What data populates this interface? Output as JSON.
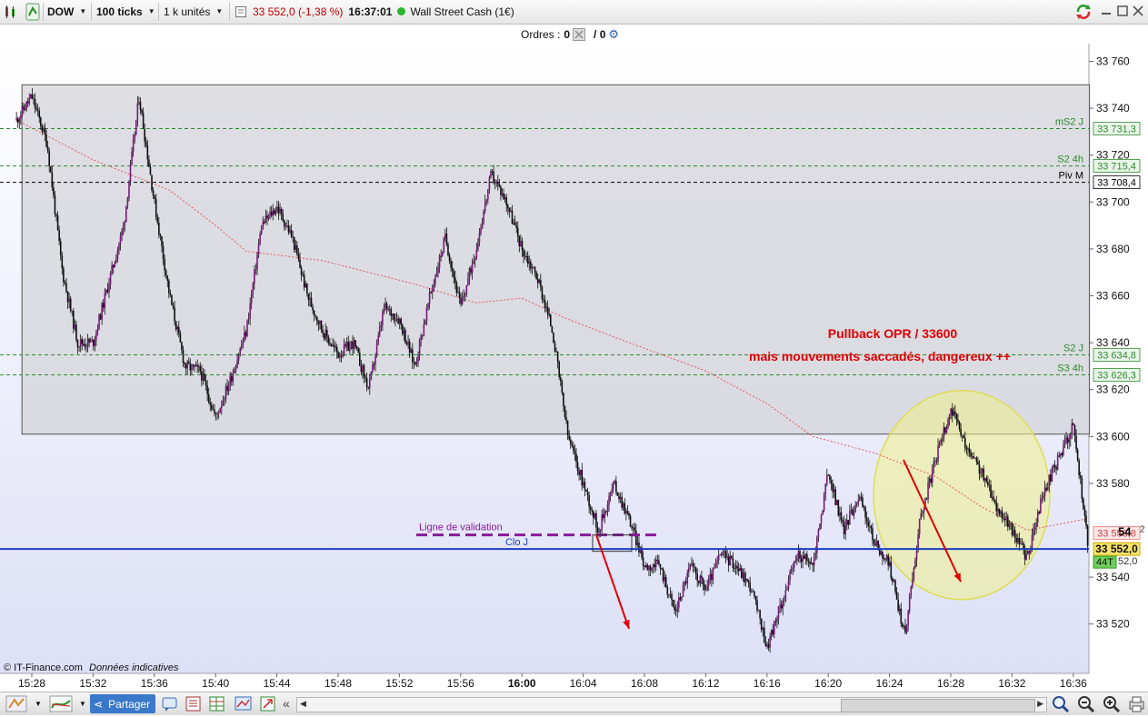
{
  "toolbar": {
    "symbol": "DOW",
    "period": "100 ticks",
    "units": "1 k unités",
    "price_change": "33 552,0 (-1,38 %)",
    "time": "16:37:01",
    "instrument": "Wall Street Cash (1€)"
  },
  "orders": {
    "label": "Ordres :",
    "count1": "0",
    "count2": "/ 0"
  },
  "chart_data": {
    "type": "candlestick",
    "title": "",
    "xlabel": "",
    "ylabel": "",
    "ylim": [
      33505,
      33768
    ],
    "x_ticks": [
      "15:28",
      "15:32",
      "15:36",
      "15:40",
      "15:44",
      "15:48",
      "15:52",
      "15:56",
      "16:00",
      "16:04",
      "16:08",
      "16:12",
      "16:16",
      "16:20",
      "16:24",
      "16:28",
      "16:32",
      "16:36"
    ],
    "y_ticks": [
      "33 760",
      "33 740",
      "33 720",
      "33 700",
      "33 680",
      "33 660",
      "33 640",
      "33 620",
      "33 600",
      "33 580",
      "33 540",
      "33 520"
    ],
    "path_anchors": [
      {
        "t": "15:27",
        "v": 33735
      },
      {
        "t": "15:28",
        "v": 33745
      },
      {
        "t": "15:29",
        "v": 33725
      },
      {
        "t": "15:30",
        "v": 33670
      },
      {
        "t": "15:31",
        "v": 33640
      },
      {
        "t": "15:32",
        "v": 33640
      },
      {
        "t": "15:33",
        "v": 33665
      },
      {
        "t": "15:34",
        "v": 33690
      },
      {
        "t": "15:35",
        "v": 33745
      },
      {
        "t": "15:36",
        "v": 33700
      },
      {
        "t": "15:37",
        "v": 33660
      },
      {
        "t": "15:38",
        "v": 33630
      },
      {
        "t": "15:39",
        "v": 33628
      },
      {
        "t": "15:40",
        "v": 33608
      },
      {
        "t": "15:41",
        "v": 33625
      },
      {
        "t": "15:42",
        "v": 33645
      },
      {
        "t": "15:43",
        "v": 33690
      },
      {
        "t": "15:44",
        "v": 33698
      },
      {
        "t": "15:45",
        "v": 33685
      },
      {
        "t": "15:46",
        "v": 33660
      },
      {
        "t": "15:47",
        "v": 33645
      },
      {
        "t": "15:48",
        "v": 33635
      },
      {
        "t": "15:49",
        "v": 33640
      },
      {
        "t": "15:50",
        "v": 33620
      },
      {
        "t": "15:51",
        "v": 33655
      },
      {
        "t": "15:52",
        "v": 33650
      },
      {
        "t": "15:53",
        "v": 33630
      },
      {
        "t": "15:54",
        "v": 33660
      },
      {
        "t": "15:55",
        "v": 33685
      },
      {
        "t": "15:56",
        "v": 33655
      },
      {
        "t": "15:57",
        "v": 33680
      },
      {
        "t": "15:58",
        "v": 33712
      },
      {
        "t": "15:59",
        "v": 33700
      },
      {
        "t": "16:00",
        "v": 33680
      },
      {
        "t": "16:01",
        "v": 33668
      },
      {
        "t": "16:02",
        "v": 33645
      },
      {
        "t": "16:03",
        "v": 33600
      },
      {
        "t": "16:04",
        "v": 33580
      },
      {
        "t": "16:05",
        "v": 33560
      },
      {
        "t": "16:06",
        "v": 33580
      },
      {
        "t": "16:07",
        "v": 33565
      },
      {
        "t": "16:08",
        "v": 33545
      },
      {
        "t": "16:09",
        "v": 33545
      },
      {
        "t": "16:10",
        "v": 33525
      },
      {
        "t": "16:11",
        "v": 33545
      },
      {
        "t": "16:12",
        "v": 33535
      },
      {
        "t": "16:13",
        "v": 33550
      },
      {
        "t": "16:14",
        "v": 33545
      },
      {
        "t": "16:15",
        "v": 33535
      },
      {
        "t": "16:16",
        "v": 33510
      },
      {
        "t": "16:17",
        "v": 33530
      },
      {
        "t": "16:18",
        "v": 33550
      },
      {
        "t": "16:19",
        "v": 33545
      },
      {
        "t": "16:20",
        "v": 33585
      },
      {
        "t": "16:21",
        "v": 33560
      },
      {
        "t": "16:22",
        "v": 33575
      },
      {
        "t": "16:23",
        "v": 33555
      },
      {
        "t": "16:24",
        "v": 33545
      },
      {
        "t": "16:25",
        "v": 33515
      },
      {
        "t": "16:26",
        "v": 33565
      },
      {
        "t": "16:27",
        "v": 33590
      },
      {
        "t": "16:28",
        "v": 33612
      },
      {
        "t": "16:29",
        "v": 33595
      },
      {
        "t": "16:30",
        "v": 33585
      },
      {
        "t": "16:31",
        "v": 33570
      },
      {
        "t": "16:32",
        "v": 33560
      },
      {
        "t": "16:33",
        "v": 33548
      },
      {
        "t": "16:34",
        "v": 33575
      },
      {
        "t": "16:35",
        "v": 33590
      },
      {
        "t": "16:36",
        "v": 33605
      },
      {
        "t": "16:37",
        "v": 33552
      }
    ],
    "ma_anchors": [
      {
        "t": "15:27",
        "v": 33735
      },
      {
        "t": "15:32",
        "v": 33718
      },
      {
        "t": "15:37",
        "v": 33705
      },
      {
        "t": "15:40",
        "v": 33690
      },
      {
        "t": "15:42",
        "v": 33679
      },
      {
        "t": "15:47",
        "v": 33675
      },
      {
        "t": "15:50",
        "v": 33670
      },
      {
        "t": "15:53",
        "v": 33665
      },
      {
        "t": "15:57",
        "v": 33657
      },
      {
        "t": "16:00",
        "v": 33659
      },
      {
        "t": "16:03",
        "v": 33650
      },
      {
        "t": "16:07",
        "v": 33640
      },
      {
        "t": "16:12",
        "v": 33628
      },
      {
        "t": "16:16",
        "v": 33614
      },
      {
        "t": "16:19",
        "v": 33600
      },
      {
        "t": "16:23",
        "v": 33593
      },
      {
        "t": "16:27",
        "v": 33583
      },
      {
        "t": "16:30",
        "v": 33570
      },
      {
        "t": "16:33",
        "v": 33560
      },
      {
        "t": "16:37",
        "v": 33565
      }
    ],
    "levels": [
      {
        "label": "mS2 J",
        "value": "33 731,3",
        "color": "#2e8b2e"
      },
      {
        "label": "S2 4h",
        "value": "33 715,4",
        "color": "#2e8b2e"
      },
      {
        "label": "Piv M",
        "value": "33 708,4",
        "color": "#000000"
      },
      {
        "label": "S2 J",
        "value": "33 634,8",
        "color": "#2e8b2e"
      },
      {
        "label": "S3 4h",
        "value": "33 626,3",
        "color": "#2e8b2e"
      }
    ],
    "level_values": [
      33731.3,
      33715.4,
      33708.4,
      33634.8,
      33626.3
    ],
    "clo_value": 33552,
    "clo_label": "Clo J",
    "validation_value": 33558,
    "validation_label": "Ligne de validation",
    "zone": {
      "from": "15:27",
      "to": "16:37",
      "high": 33750,
      "low": 33601
    },
    "current_price": "33 552,0",
    "tag_558": "33 558,8",
    "tag_44t": "44T",
    "tag_partial_a": "54",
    "tag_partial_b": "52,0",
    "tag_partial_c": "2",
    "annotation_line1": "Pullback OPR / 33600",
    "annotation_line2": "mais mouvements saccadés, dangereux ++",
    "watermark_brand": "© IT-Finance.com",
    "watermark_note": "Données indicatives",
    "colors": {
      "up": "#7a1a7a",
      "down": "#111111",
      "zone": "#d6d6dc",
      "clo": "#1a3fbf",
      "validation": "#8a1a9a",
      "annotation": "#e00000",
      "highlight": "#eef08a"
    }
  },
  "bottom": {
    "share_label": "Partager"
  }
}
